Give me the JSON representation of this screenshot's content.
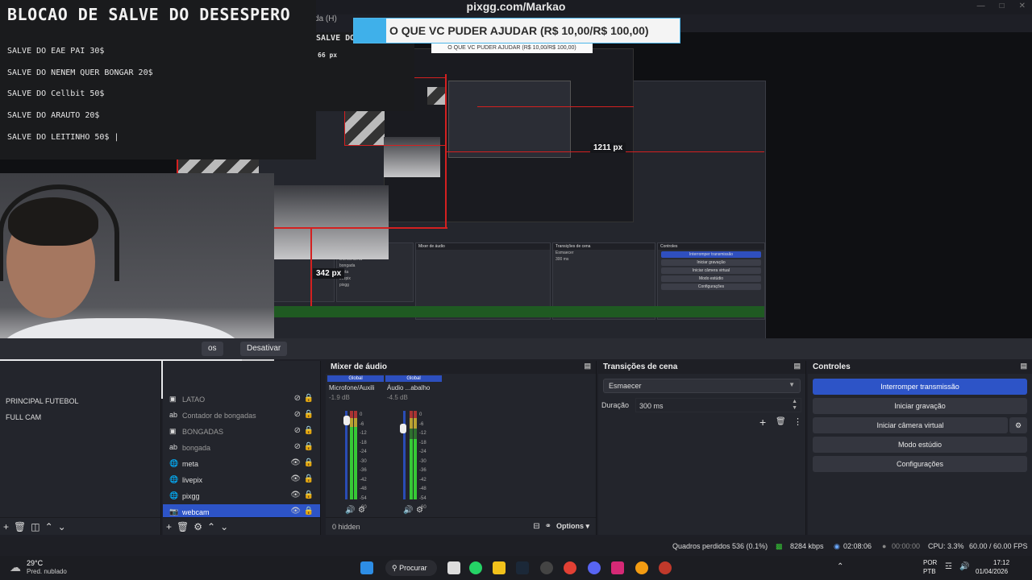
{
  "window": {
    "title": "pixgg.com/Markao",
    "menu_fragment": "da (H)"
  },
  "overlay": {
    "title": "BLOCAO DE SALVE DO DESESPERO",
    "lines": [
      "SALVE DO EAE PAI 30$",
      "SALVE DO NENEM QUER BONGAR 20$",
      "SALVE DO Cellbit 50$",
      "SALVE DO ARAUTO 20$",
      "SALVE DO LEITINHO 50$ |"
    ],
    "nested_title": "SALVE DO",
    "nested_px": "66 px"
  },
  "pix_banner": {
    "text": "O QUE VC PUDER AJUDAR (R$ 10,00/R$ 100,00)",
    "small_text": "O QUE VC PUDER AJUDAR (R$ 10,00/R$ 100,00)"
  },
  "preview_labels": {
    "px_wide": "1211 px",
    "px_tall": "342 px"
  },
  "scene_toolbar": {
    "fragment": "os",
    "deactivate": "Desativar"
  },
  "scenes": {
    "items": [
      "PRINCIPAL FUTEBOL",
      "FULL CAM"
    ]
  },
  "sources": {
    "items": [
      {
        "name": "LATAO",
        "icon": "image-icon",
        "visible": false
      },
      {
        "name": "Contador de bongadas",
        "icon": "text-icon",
        "visible": false
      },
      {
        "name": "BONGADAS",
        "icon": "image-icon",
        "visible": false
      },
      {
        "name": "bongada",
        "icon": "text-icon",
        "visible": false
      },
      {
        "name": "meta",
        "icon": "globe-icon",
        "visible": true
      },
      {
        "name": "livepix",
        "icon": "globe-icon",
        "visible": true
      },
      {
        "name": "pixgg",
        "icon": "globe-icon",
        "visible": true
      },
      {
        "name": "webcam",
        "icon": "camera-icon",
        "visible": true
      }
    ]
  },
  "mixer": {
    "title": "Mixer de áudio",
    "channels": [
      {
        "tag": "Global",
        "name": "Microfone/Auxili",
        "db": "-1.9 dB",
        "level": 0.82
      },
      {
        "tag": "Global",
        "name": "Áudio ...abalho",
        "db": "-4.5 dB",
        "level": 0.68
      }
    ],
    "scale": [
      "0",
      "-6",
      "-12",
      "-18",
      "-24",
      "-30",
      "-36",
      "-42",
      "-48",
      "-54",
      "-60"
    ],
    "hidden": "0 hidden",
    "options": "Options"
  },
  "transitions": {
    "title": "Transições de cena",
    "selected": "Esmaecer",
    "duration_label": "Duração",
    "duration_value": "300 ms"
  },
  "controls": {
    "title": "Controles",
    "buttons": [
      "Interromper transmissão",
      "Iniciar gravação",
      "Iniciar câmera virtual",
      "Modo estúdio",
      "Configurações"
    ]
  },
  "status": {
    "dropped": "Quadros perdidos 536 (0.1%)",
    "bitrate": "8284 kbps",
    "stream_time": "02:08:06",
    "rec_time": "00:00:00",
    "cpu": "CPU: 3.3%",
    "fps": "60.00 / 60.00 FPS"
  },
  "taskbar": {
    "weather_temp": "29°C",
    "weather_desc": "Pred. nublado",
    "search": "Procurar",
    "lang": "POR",
    "layout": "PTB",
    "time": "17:12",
    "date": "01/04/2026"
  },
  "colors": {
    "accent": "#2d54c7",
    "red": "#d42020",
    "green": "#36c936"
  }
}
